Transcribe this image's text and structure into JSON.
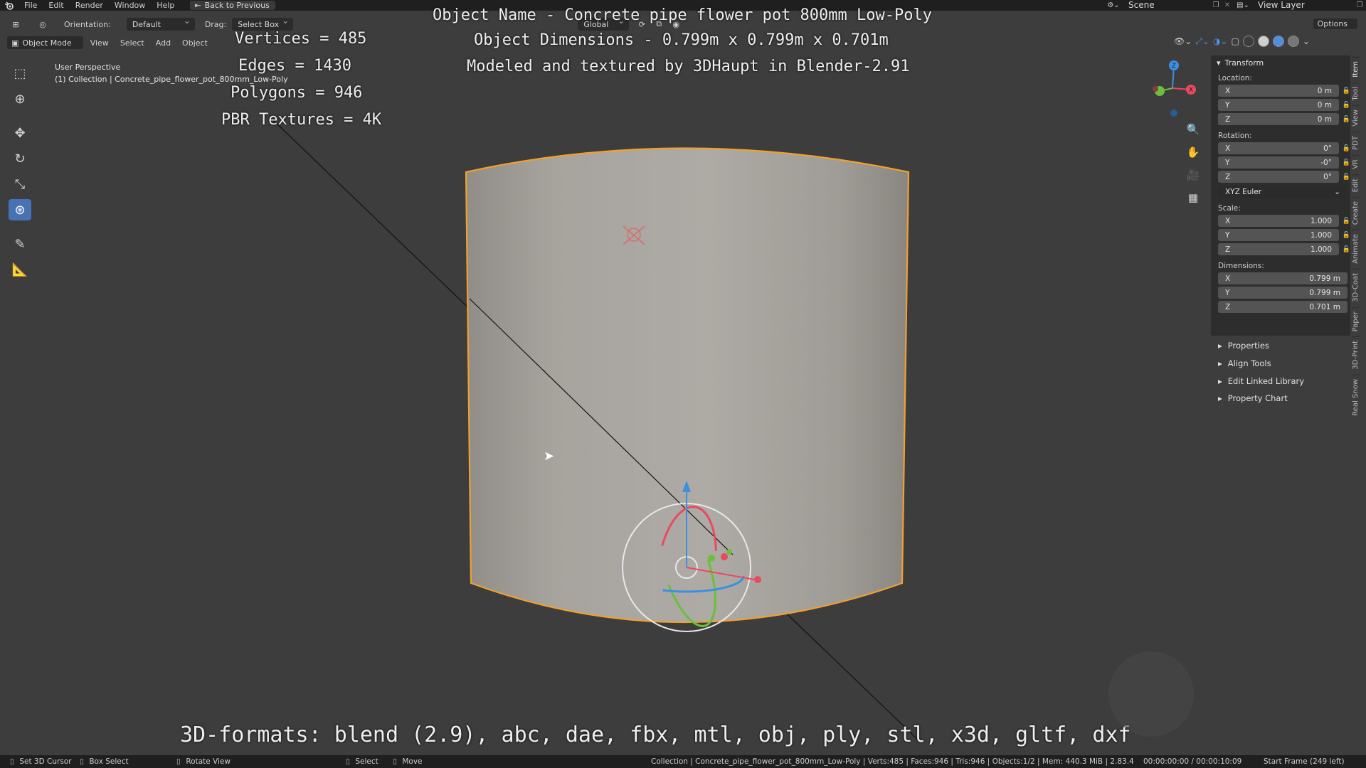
{
  "topbar": {
    "menu": [
      "File",
      "Edit",
      "Render",
      "Window",
      "Help"
    ],
    "back_label": "Back to Previous",
    "scene_label": "Scene",
    "view_layer_label": "View Layer"
  },
  "header": {
    "orientation_label": "Orientation:",
    "orientation_value": "Default",
    "drag_label": "Drag:",
    "drag_value": "Select Box",
    "transform_space": "Global",
    "options_label": "Options"
  },
  "view_header": {
    "mode": "Object Mode",
    "menus": [
      "View",
      "Select",
      "Add",
      "Object"
    ]
  },
  "viewport": {
    "perspective": "User Perspective",
    "collection_line": "(1) Collection | Concrete_pipe_flower_pot_800mm_Low-Poly"
  },
  "overlay": {
    "object_name": "Object Name - Concrete pipe flower pot 800mm Low-Poly",
    "object_dimensions": "Object Dimensions -  0.799m x 0.799m x 0.701m",
    "credit": "Modeled and textured by 3DHaupt in Blender-2.91",
    "vertices": "Vertices = 485",
    "edges": "Edges = 1430",
    "polygons": "Polygons = 946",
    "textures": "PBR Textures = 4K",
    "formats": "3D-formats: blend (2.9), abc, dae, fbx, mtl, obj, ply, stl, x3d, gltf, dxf"
  },
  "gizmo_axes": {
    "x": "X",
    "y": "Y",
    "z": "Z"
  },
  "npanel": {
    "title": "Transform",
    "location_label": "Location:",
    "location": [
      {
        "axis": "X",
        "value": "0 m"
      },
      {
        "axis": "Y",
        "value": "0 m"
      },
      {
        "axis": "Z",
        "value": "0 m"
      }
    ],
    "rotation_label": "Rotation:",
    "rotation": [
      {
        "axis": "X",
        "value": "0°"
      },
      {
        "axis": "Y",
        "value": "-0°"
      },
      {
        "axis": "Z",
        "value": "0°"
      }
    ],
    "rotation_mode": "XYZ Euler",
    "scale_label": "Scale:",
    "scale": [
      {
        "axis": "X",
        "value": "1.000"
      },
      {
        "axis": "Y",
        "value": "1.000"
      },
      {
        "axis": "Z",
        "value": "1.000"
      }
    ],
    "dimensions_label": "Dimensions:",
    "dimensions": [
      {
        "axis": "X",
        "value": "0.799 m"
      },
      {
        "axis": "Y",
        "value": "0.799 m"
      },
      {
        "axis": "Z",
        "value": "0.701 m"
      }
    ],
    "collapsed_sections": [
      "Properties",
      "Align Tools",
      "Edit Linked Library",
      "Property Chart"
    ]
  },
  "side_tabs": [
    "Item",
    "Tool",
    "View",
    "PDT",
    "VR",
    "Edit",
    "Create",
    "Animate",
    "3D-Coat",
    "Paper",
    "3D-Print",
    "Real Snow"
  ],
  "statusbar": {
    "set_cursor": "Set 3D Cursor",
    "box_select": "Box Select",
    "rotate_view": "Rotate View",
    "select": "Select",
    "move": "Move",
    "stats": "Collection | Concrete_pipe_flower_pot_800mm_Low-Poly | Verts:485 | Faces:946 | Tris:946 | Objects:1/2 | Mem: 440.3 MiB | 2.83.4",
    "time": "00:00:00:00 / 00:00:10:09",
    "frame": "Start Frame (249 left)"
  },
  "colors": {
    "viewport_bg": "#3d3d3d",
    "selection_outline": "#f0a030",
    "active_tool": "#4772b3",
    "axis_x": "#e84a5f",
    "axis_y": "#6bbf3b",
    "axis_z": "#3d8fe0"
  }
}
